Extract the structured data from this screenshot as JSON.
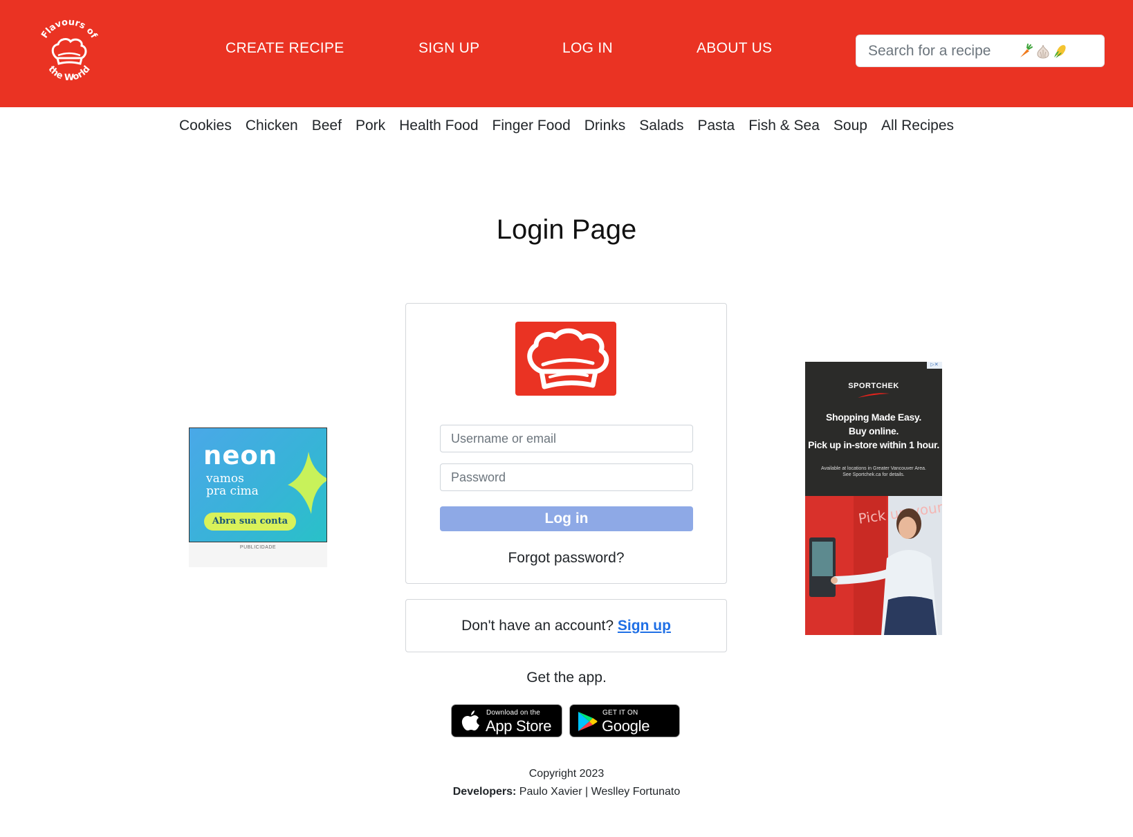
{
  "brand": {
    "logo_top_text": "Flavours of",
    "logo_bottom_text": "the World",
    "accent_color": "#ea3323"
  },
  "nav": {
    "create_recipe": "CREATE RECIPE",
    "sign_up": "SIGN UP",
    "log_in": "LOG IN",
    "about_us": "ABOUT US"
  },
  "search": {
    "placeholder": "Search for a recipe",
    "icons": [
      "carrot-icon",
      "garlic-icon",
      "corn-icon"
    ]
  },
  "categories": [
    "Cookies",
    "Chicken",
    "Beef",
    "Pork",
    "Health Food",
    "Finger Food",
    "Drinks",
    "Salads",
    "Pasta",
    "Fish & Sea",
    "Soup",
    "All Recipes"
  ],
  "page": {
    "title": "Login Page"
  },
  "login": {
    "username_placeholder": "Username or email",
    "password_placeholder": "Password",
    "login_button": "Log in",
    "forgot_password": "Forgot password?",
    "no_account_text": "Don't have an account?",
    "sign_up_link": "Sign up",
    "button_color": "#8ea9e6"
  },
  "app": {
    "get_the_app": "Get the app.",
    "app_store_small": "Download on the",
    "app_store_big": "App Store",
    "google_play_small": "GET IT ON",
    "google_play_big": "Google Play"
  },
  "ad_left": {
    "logo": "neon",
    "tagline_1": "vamos",
    "tagline_2": "pra cima",
    "cta": "Abra sua conta",
    "label": "PUBLICIDADE"
  },
  "ad_right": {
    "brand": "SPORTCHEK",
    "headline_1": "Shopping Made Easy.",
    "headline_2": "Buy online.",
    "headline_3": "Pick up in-store within 1 hour.",
    "fine_print_1": "Available at locations in Greater Vancouver Area.",
    "fine_print_2": "See Sportchek.ca for details.",
    "photo_text": "Pick up your order"
  },
  "footer": {
    "copyright": "Copyright 2023",
    "developers_label": "Developers:",
    "developer_1": "Paulo Xavier",
    "separator": "|",
    "developer_2": "Weslley Fortunato"
  }
}
